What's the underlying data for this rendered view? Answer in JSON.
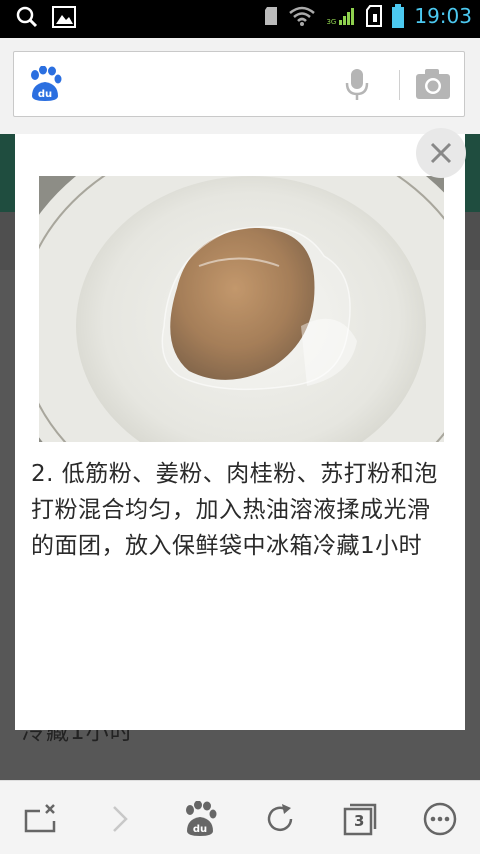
{
  "status_bar": {
    "time": "19:03",
    "network_label": "3G",
    "icons": [
      "search-icon",
      "image-icon",
      "sd-card-icon",
      "wifi-icon",
      "signal-icon",
      "sim-icon",
      "battery-icon"
    ]
  },
  "search": {
    "logo": "du",
    "icons": [
      "baidu-paw-icon",
      "microphone-icon",
      "camera-icon"
    ]
  },
  "popup": {
    "caption": "2. 低筋粉、姜粉、肉桂粉、苏打粉和泡打粉混合均匀，加入热油溶液揉成光滑的面团，放入保鲜袋中冰箱冷藏1小时",
    "image_subject": "dough-in-plastic-wrap-on-plate",
    "close_icon": "close-icon"
  },
  "background_page": {
    "partial_text": "冷藏1小时"
  },
  "toolbar": {
    "tab_count": "3",
    "logo_label": "du",
    "icons": [
      "close-tab-icon",
      "forward-icon",
      "baidu-home-icon",
      "refresh-icon",
      "tabs-icon",
      "menu-icon"
    ]
  },
  "colors": {
    "accent_blue": "#2b6fe0",
    "status_time": "#4cc9f0",
    "header_green": "#1f4d3f"
  }
}
